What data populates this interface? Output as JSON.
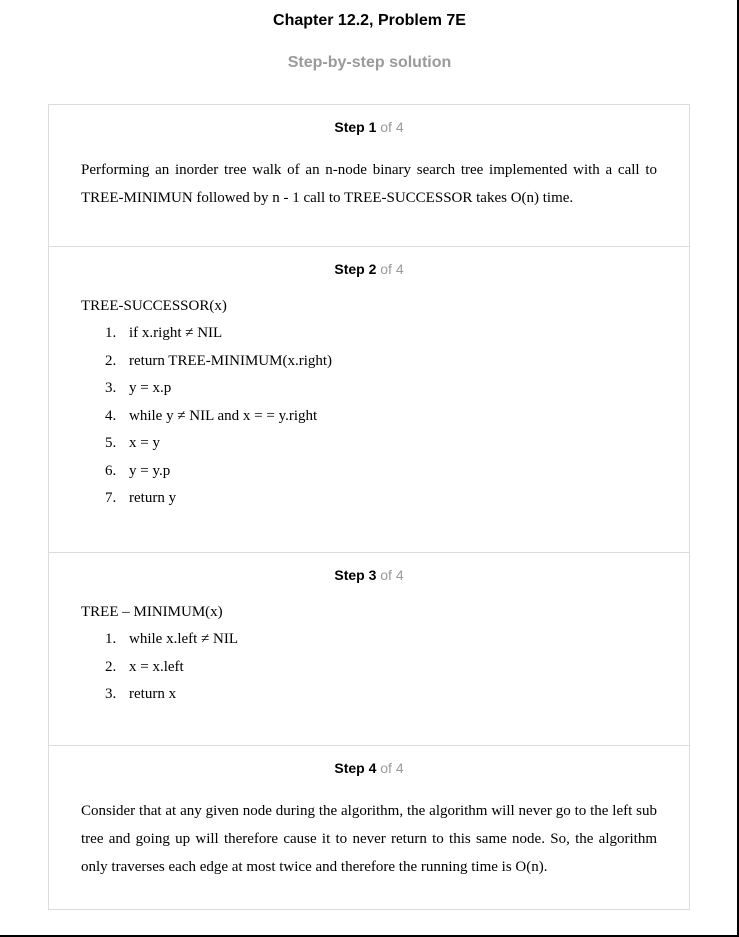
{
  "header": {
    "title": "Chapter 12.2, Problem 7E",
    "subtitle": "Step-by-step solution"
  },
  "steps": [
    {
      "label": "Step 1",
      "of": "of 4",
      "paragraph": "Performing an inorder tree walk of an n-node binary search tree implemented with a call to TREE-MINIMUN followed by n - 1 call to TREE-SUCCESSOR takes O(n) time."
    },
    {
      "label": "Step 2",
      "of": "of 4",
      "code_title": "TREE-SUCCESSOR(x)",
      "lines": [
        {
          "n": "1.",
          "text": "if x.right ≠ NIL"
        },
        {
          "n": "2.",
          "text": "return TREE-MINIMUM(x.right)"
        },
        {
          "n": "3.",
          "text": "y = x.p"
        },
        {
          "n": "4.",
          "text": "while y  ≠  NIL and x = = y.right"
        },
        {
          "n": "5.",
          "text": "x = y"
        },
        {
          "n": "6.",
          "text": "y = y.p"
        },
        {
          "n": "7.",
          "text": "return y"
        }
      ]
    },
    {
      "label": "Step 3",
      "of": "of 4",
      "code_title": "TREE – MINIMUM(x)",
      "lines": [
        {
          "n": "1.",
          "text": "while x.left  ≠ NIL"
        },
        {
          "n": "2.",
          "text": "x = x.left"
        },
        {
          "n": "3.",
          "text": "return x"
        }
      ]
    },
    {
      "label": "Step 4",
      "of": "of 4",
      "paragraph": "Consider that at any given node during the algorithm, the algorithm will never go to the left sub tree and going up will therefore cause it to never return to this same node. So, the algorithm only traverses each edge at most twice and therefore the running time is O(n)."
    }
  ]
}
